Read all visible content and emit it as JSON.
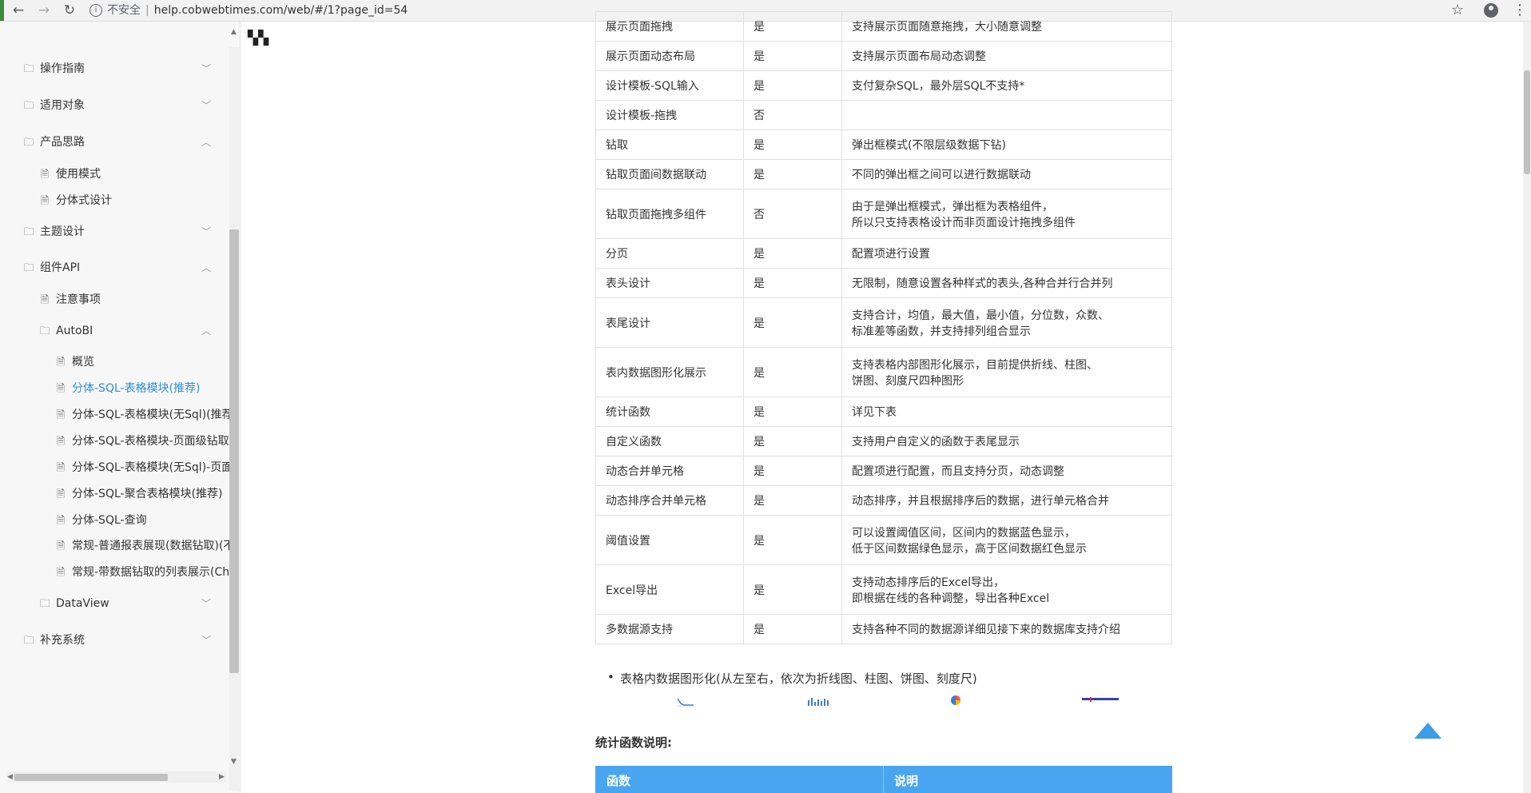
{
  "browser": {
    "insecure_label": "不安全",
    "separator": "|",
    "url": "help.cobwebtimes.com/web/#/1?page_id=54"
  },
  "sidebar": {
    "items": [
      {
        "label": "操作指南",
        "level": 0,
        "type": "folder",
        "expanded": false
      },
      {
        "label": "适用对象",
        "level": 0,
        "type": "folder",
        "expanded": false
      },
      {
        "label": "产品思路",
        "level": 0,
        "type": "folder",
        "expanded": true
      },
      {
        "label": "使用模式",
        "level": 1,
        "type": "page"
      },
      {
        "label": "分体式设计",
        "level": 1,
        "type": "page"
      },
      {
        "label": "主题设计",
        "level": 0,
        "type": "folder",
        "expanded": false
      },
      {
        "label": "组件API",
        "level": 0,
        "type": "folder",
        "expanded": true
      },
      {
        "label": "注意事项",
        "level": 1,
        "type": "page"
      },
      {
        "label": "AutoBI",
        "level": 1,
        "type": "folder",
        "expanded": true
      },
      {
        "label": "概览",
        "level": 2,
        "type": "page"
      },
      {
        "label": "分体-SQL-表格模块(推荐)",
        "level": 2,
        "type": "page",
        "active": true
      },
      {
        "label": "分体-SQL-表格模块(无Sql)(推荐",
        "level": 2,
        "type": "page"
      },
      {
        "label": "分体-SQL-表格模块-页面级钻取",
        "level": 2,
        "type": "page"
      },
      {
        "label": "分体-SQL-表格模块(无Sql)-页面",
        "level": 2,
        "type": "page"
      },
      {
        "label": "分体-SQL-聚合表格模块(推荐)",
        "level": 2,
        "type": "page"
      },
      {
        "label": "分体-SQL-查询",
        "level": 2,
        "type": "page"
      },
      {
        "label": "常规-普通报表展现(数据钻取)(不",
        "level": 2,
        "type": "page"
      },
      {
        "label": "常规-带数据钻取的列表展示(Ch",
        "level": 2,
        "type": "page"
      },
      {
        "label": "DataView",
        "level": 1,
        "type": "folder",
        "expanded": false
      },
      {
        "label": "补充系统",
        "level": 0,
        "type": "folder",
        "expanded": false
      }
    ]
  },
  "feature_table": {
    "rows": [
      {
        "feature": "展示页面拖拽",
        "supported": "是",
        "note": "支持展示页面随意拖拽，大小随意调整"
      },
      {
        "feature": "展示页面动态布局",
        "supported": "是",
        "note": "支持展示页面布局动态调整"
      },
      {
        "feature": "设计模板-SQL输入",
        "supported": "是",
        "note": "支付复杂SQL，最外层SQL不支持*"
      },
      {
        "feature": "设计模板-拖拽",
        "supported": "否",
        "note": ""
      },
      {
        "feature": "钻取",
        "supported": "是",
        "note": "弹出框模式(不限层级数据下钻)"
      },
      {
        "feature": "钻取页面间数据联动",
        "supported": "是",
        "note": "不同的弹出框之间可以进行数据联动"
      },
      {
        "feature": "钻取页面拖拽多组件",
        "supported": "否",
        "note": "由于是弹出框模式，弹出框为表格组件，",
        "note2": "所以只支持表格设计而非页面设计拖拽多组件"
      },
      {
        "feature": "分页",
        "supported": "是",
        "note": "配置项进行设置"
      },
      {
        "feature": "表头设计",
        "supported": "是",
        "note": "无限制，随意设置各种样式的表头,各种合并行合并列"
      },
      {
        "feature": "表尾设计",
        "supported": "是",
        "note": "支持合计，均值，最大值，最小值，分位数，众数、",
        "note2": "标准差等函数，并支持排列组合显示"
      },
      {
        "feature": "表内数据图形化展示",
        "supported": "是",
        "note": "支持表格内部图形化展示，目前提供折线、柱图、",
        "note2": "饼图、刻度尺四种图形"
      },
      {
        "feature": "统计函数",
        "supported": "是",
        "note": "详见下表"
      },
      {
        "feature": "自定义函数",
        "supported": "是",
        "note": "支持用户自定义的函数于表尾显示"
      },
      {
        "feature": "动态合并单元格",
        "supported": "是",
        "note": "配置项进行配置，而且支持分页，动态调整"
      },
      {
        "feature": "动态排序合并单元格",
        "supported": "是",
        "note": "动态排序，并且根据排序后的数据，进行单元格合并"
      },
      {
        "feature": "阈值设置",
        "supported": "是",
        "note": "可以设置阈值区间，区间内的数据蓝色显示，",
        "note2": "低于区间数据绿色显示，高于区间数据红色显示"
      },
      {
        "feature": "Excel导出",
        "supported": "是",
        "note": "支持动态排序后的Excel导出，",
        "note2": "即根据在线的各种调整，导出各种Excel"
      },
      {
        "feature": "多数据源支持",
        "supported": "是",
        "note": "支持各种不同的数据源详细见接下来的数据库支持介绍"
      }
    ]
  },
  "bullet_text": "表格内数据图形化(从左至右，依次为折线图、柱图、饼图、刻度尺)",
  "stats": {
    "title": "统计函数说明:",
    "col_function": "函数",
    "col_desc": "说明"
  },
  "colors": {
    "accent": "#2b8fd8",
    "table_header": "#4aa5f0",
    "back_to_top": "#3d9de6"
  }
}
